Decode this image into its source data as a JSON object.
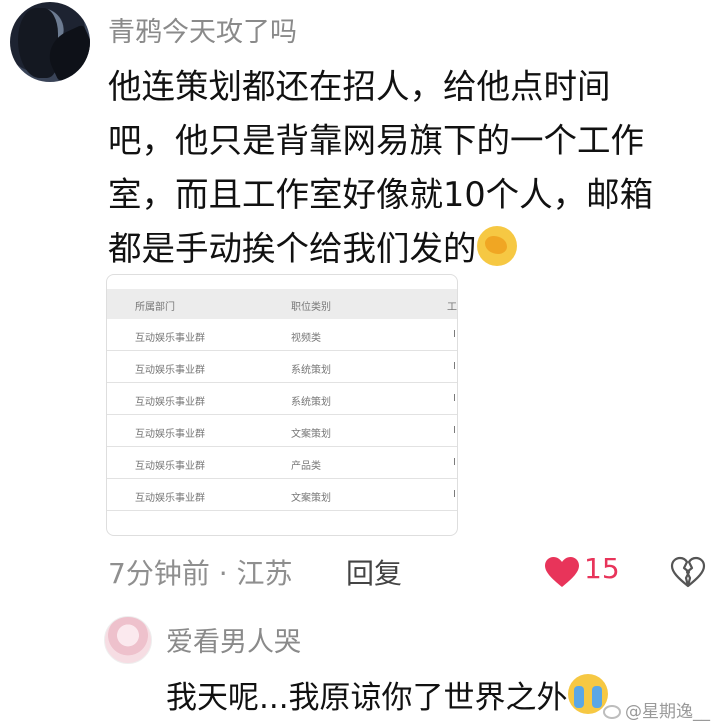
{
  "post": {
    "username": "青鸦今天攻了吗",
    "comment_lines": [
      "他连策划都还在招人，给他点时间",
      "吧，他只是背靠网易旗下的一个工作",
      "室，而且工作室好像就10个人，邮箱",
      "都是手动挨个给我们发的"
    ],
    "emoji": "facepalm-emoji"
  },
  "job_table": {
    "headers": [
      "所属部门",
      "职位类别",
      "工"
    ],
    "rows": [
      [
        "互动娱乐事业群",
        "视频类",
        "I"
      ],
      [
        "互动娱乐事业群",
        "系统策划",
        "I"
      ],
      [
        "互动娱乐事业群",
        "系统策划",
        "I"
      ],
      [
        "互动娱乐事业群",
        "文案策划",
        "I"
      ],
      [
        "互动娱乐事业群",
        "产品类",
        "I"
      ],
      [
        "互动娱乐事业群",
        "文案策划",
        "I"
      ]
    ]
  },
  "meta": {
    "time_location": "7分钟前 · 江苏",
    "reply_label": "回复",
    "like_count": "15",
    "like_color": "#e8345a"
  },
  "reply": {
    "username": "爱看男人哭",
    "text": "我天呢...我原谅你了世界之外",
    "emoji": "crying-emoji"
  },
  "watermark": {
    "text": "@星期逸__"
  }
}
